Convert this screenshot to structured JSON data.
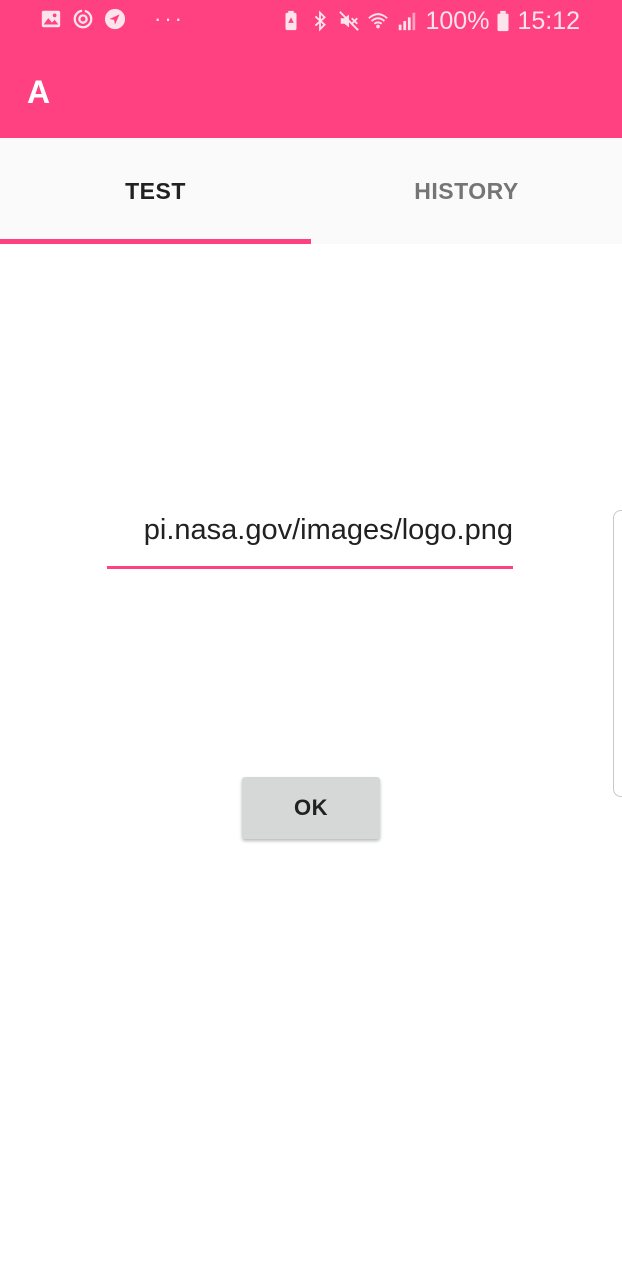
{
  "status_bar": {
    "icons_left": [
      "image-icon",
      "sync-icon",
      "send-icon"
    ],
    "more": "···",
    "icons_right": [
      "battery-saver-icon",
      "bluetooth-icon",
      "mute-icon",
      "wifi-icon",
      "signal-icon"
    ],
    "battery": "100%",
    "time": "15:12",
    "color": "#ff4081"
  },
  "app_bar": {
    "title": "A",
    "color": "#ff4081"
  },
  "tabs": [
    {
      "label": "TEST",
      "selected": true
    },
    {
      "label": "HISTORY",
      "selected": false
    }
  ],
  "form": {
    "url_value": "pi.nasa.gov/images/logo.png",
    "ok_label": "OK"
  }
}
